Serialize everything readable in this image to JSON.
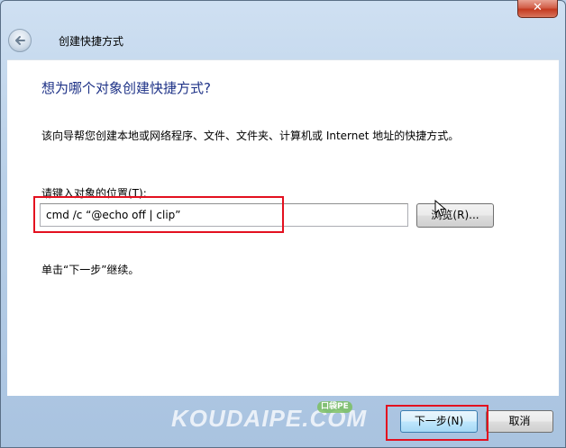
{
  "window": {
    "title": "创建快捷方式",
    "close_glyph": "✕"
  },
  "page": {
    "heading": "想为哪个对象创建快捷方式?",
    "description": "该向导帮您创建本地或网络程序、文件、文件夹、计算机或 Internet 地址的快捷方式。",
    "location_label": "请键入对象的位置(T):",
    "location_value": "cmd /c  “@echo off | clip”",
    "browse_label": "浏览(R)...",
    "hint": "单击“下一步”继续。"
  },
  "footer": {
    "next_label": "下一步(N)",
    "cancel_label": "取消"
  },
  "watermark": {
    "text": "KOUDAIPE.COM",
    "badge": "口袋PE"
  },
  "colors": {
    "heading": "#1e3287",
    "highlight": "#e3101f"
  },
  "icons": {
    "back": "back-arrow-icon",
    "close": "close-icon",
    "cursor": "mouse-cursor-icon"
  }
}
